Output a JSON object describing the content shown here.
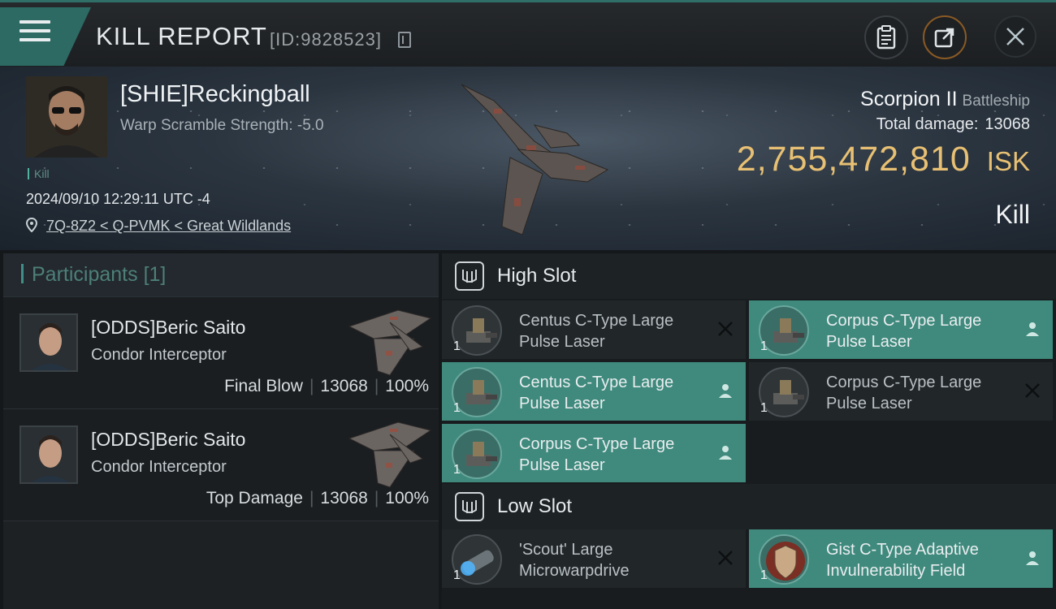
{
  "titlebar": {
    "title": "KILL REPORT",
    "report_id": "[ID:9828523]",
    "buttons": [
      "clipboard-icon",
      "share-icon",
      "close-icon"
    ]
  },
  "victim": {
    "name": "[SHIE]Reckingball",
    "warp_scramble": "Warp Scramble Strength: -5.0",
    "tag": "Kill",
    "datetime": "2024/09/10 12:29:11 UTC -4",
    "location": "7Q-8Z2 < Q-PVMK < Great Wildlands"
  },
  "ship": {
    "name": "Scorpion II",
    "class": "Battleship",
    "total_damage_label": "Total damage:",
    "total_damage_value": "13068",
    "isk_value": "2,755,472,810",
    "isk_unit": "ISK",
    "result": "Kill"
  },
  "participants": {
    "header": "Participants",
    "count": "[1]",
    "rows": [
      {
        "name": "[ODDS]Beric Saito",
        "ship": "Condor Interceptor",
        "role": "Final Blow",
        "damage": "13068",
        "percent": "100%"
      },
      {
        "name": "[ODDS]Beric Saito",
        "ship": "Condor Interceptor",
        "role": "Top Damage",
        "damage": "13068",
        "percent": "100%"
      }
    ]
  },
  "slots": {
    "high": {
      "title": "High Slot",
      "items": [
        {
          "name": "Centus C-Type Large Pulse Laser",
          "qty": "1",
          "status": "destroyed"
        },
        {
          "name": "Corpus C-Type Large Pulse Laser",
          "qty": "1",
          "status": "dropped"
        },
        {
          "name": "Centus C-Type Large Pulse Laser",
          "qty": "1",
          "status": "dropped"
        },
        {
          "name": "Corpus C-Type Large Pulse Laser",
          "qty": "1",
          "status": "destroyed"
        },
        {
          "name": "Corpus C-Type Large Pulse Laser",
          "qty": "1",
          "status": "dropped"
        }
      ]
    },
    "low": {
      "title": "Low Slot",
      "items": [
        {
          "name": "'Scout' Large Microwarpdrive",
          "qty": "1",
          "status": "destroyed"
        },
        {
          "name": "Gist C-Type Adaptive Invulnerability Field",
          "qty": "1",
          "status": "dropped"
        }
      ]
    }
  },
  "colors": {
    "accent_teal": "#3f8a7d",
    "isk_gold": "#e8c073",
    "menu_tab": "#2d6a63"
  }
}
